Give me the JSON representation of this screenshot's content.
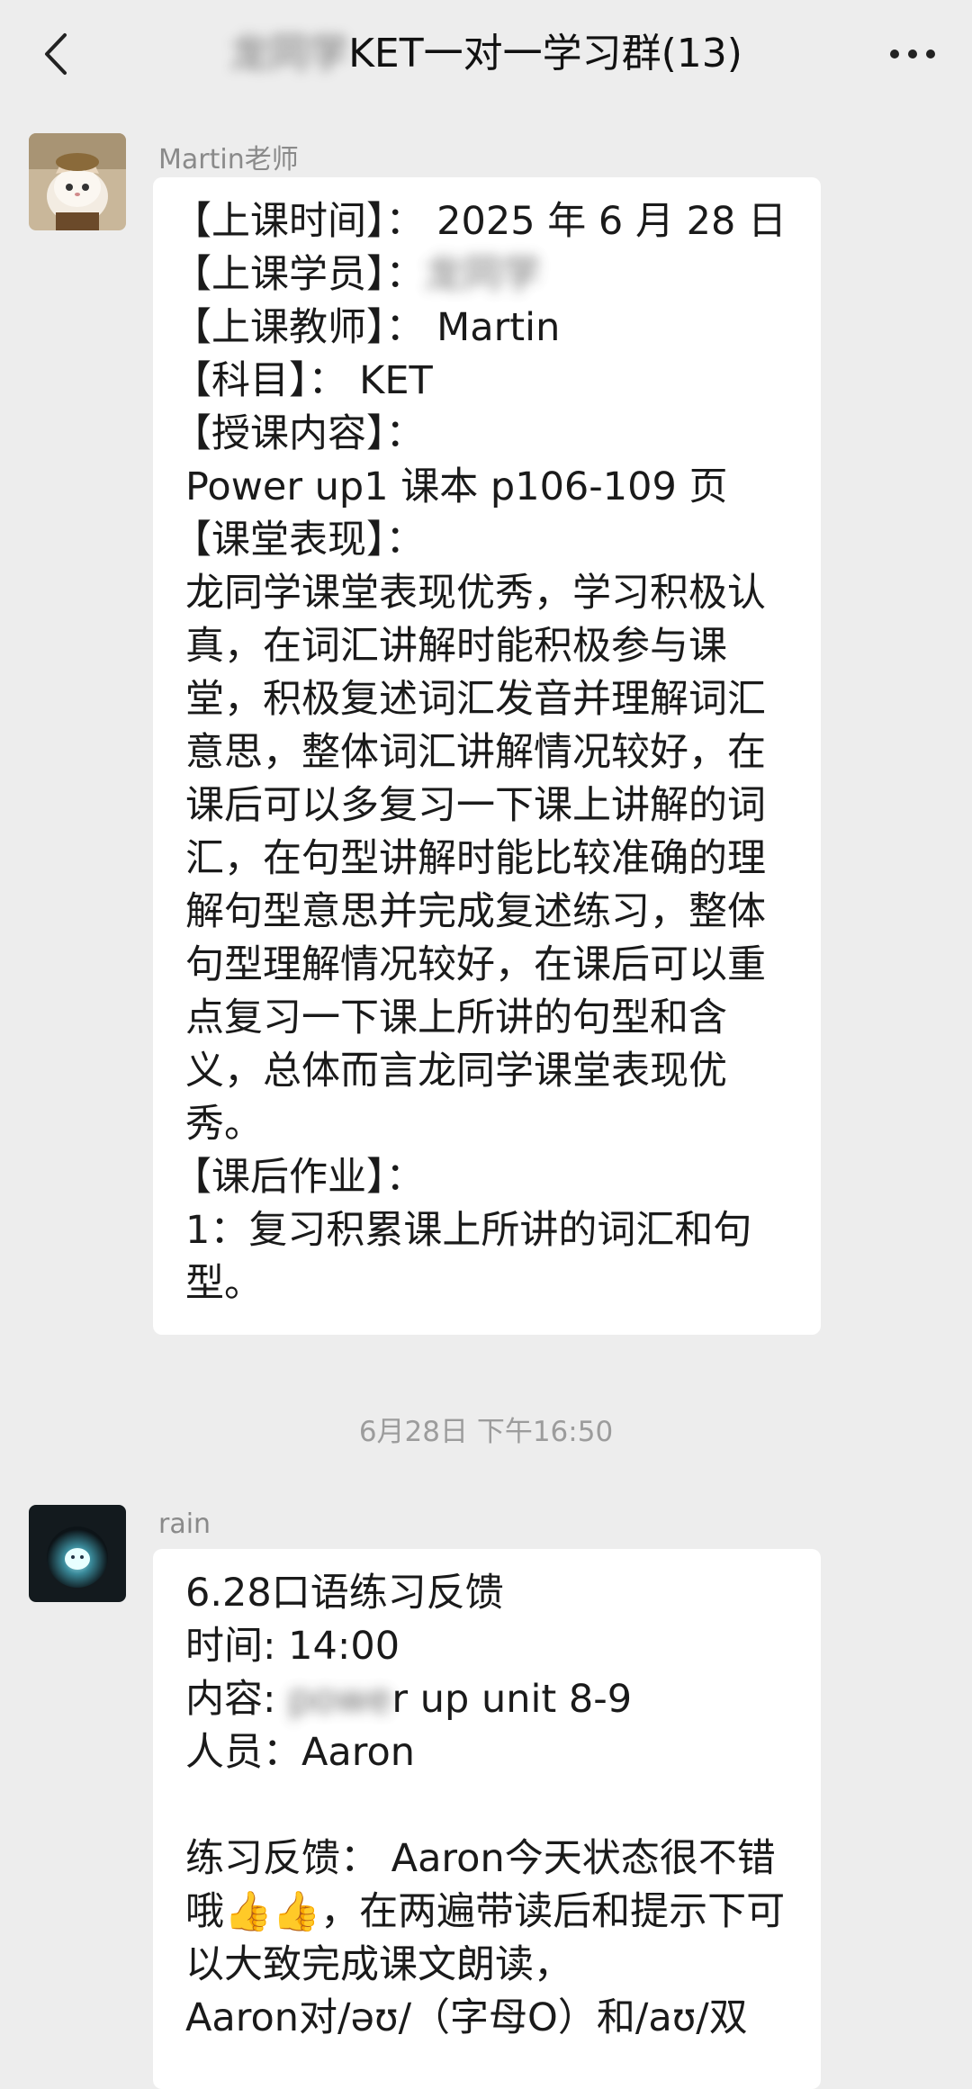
{
  "header": {
    "title_blurred": "龙同学",
    "title_suffix": "KET一对一学习群(13)",
    "back_icon": "chevron-left-icon",
    "more_icon": "more-dots-icon"
  },
  "messages": [
    {
      "sender": "Martin老师",
      "lines": {
        "l1": "【上课时间】： 2025 年 6 月 28 日",
        "l2_label": "【上课学员】：",
        "l2_blurred": "龙同学",
        "l3": "【上课教师】： Martin",
        "l4": "【科目】： KET",
        "l5": "【授课内容】：",
        "l6": "Power up1 课本 p106-109 页",
        "l7": "【课堂表现】：",
        "l8": "龙同学课堂表现优秀，学习积极认真，在词汇讲解时能积极参与课堂，积极复述词汇发音并理解词汇意思，整体词汇讲解情况较好，在课后可以多复习一下课上讲解的词汇，在句型讲解时能比较准确的理解句型意思并完成复述练习，整体句型理解情况较好，在课后可以重点复习一下课上所讲的句型和含义，总体而言龙同学课堂表现优秀。",
        "l9": "【课后作业】：",
        "l10": "1：复习积累课上所讲的词汇和句型。"
      }
    },
    {
      "sender": "rain",
      "lines": {
        "l1": "6.28口语练习反馈",
        "l2": "时间: 14:00",
        "l3_prefix": "内容: ",
        "l3_blurred": "powe",
        "l3_suffix": "r up unit 8-9",
        "l4": "人员：Aaron",
        "l5": "练习反馈： Aaron今天状态很不错哦👍👍，在两遍带读后和提示下可以大致完成课文朗读，",
        "l6": "Aaron对/əʊ/（字母O）和/aʊ/双"
      }
    }
  ],
  "timestamp": "6月28日 下午16:50"
}
